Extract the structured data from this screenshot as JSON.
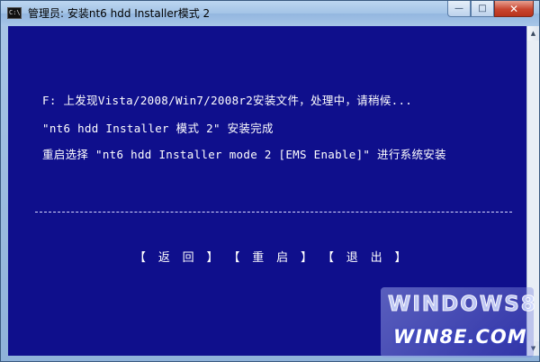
{
  "window": {
    "title": "管理员:  安装nt6 hdd Installer模式 2",
    "icon_label": "C:\\",
    "controls": {
      "minimize": "—",
      "maximize": "□",
      "close": "✕"
    }
  },
  "console": {
    "lines": [
      "F: 上发现Vista/2008/Win7/2008r2安装文件，处理中，请稍候...",
      "\"nt6 hdd Installer 模式 2\" 安装完成",
      "重启选择 \"nt6 hdd Installer mode 2 [EMS Enable]\" 进行系统安装"
    ],
    "separator_char": "-",
    "menu": [
      {
        "label": "【 返 回 】"
      },
      {
        "label": "【 重 启 】"
      },
      {
        "label": "【 退 出 】"
      }
    ]
  },
  "scrollbar": {
    "up_arrow": "▲",
    "down_arrow": "▼"
  },
  "watermark": {
    "top": "WINDOWS8",
    "bottom": "WIN8E.COM"
  }
}
